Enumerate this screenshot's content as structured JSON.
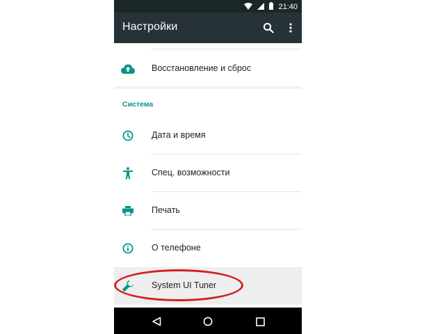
{
  "statusbar": {
    "time": "21:40",
    "icons": [
      "wifi-icon",
      "signal-icon",
      "battery-icon"
    ]
  },
  "appbar": {
    "title": "Настройки",
    "actions": [
      "search-icon",
      "more-vert-icon"
    ]
  },
  "top_item": {
    "label": "Восстановление и сброс",
    "icon": "cloud-upload-icon"
  },
  "section": {
    "header": "Система",
    "items": [
      {
        "label": "Дата и время",
        "icon": "clock-icon"
      },
      {
        "label": "Спец. возможности",
        "icon": "accessibility-icon"
      },
      {
        "label": "Печать",
        "icon": "printer-icon"
      },
      {
        "label": "О телефоне",
        "icon": "info-icon"
      },
      {
        "label": "System UI Tuner",
        "icon": "wrench-icon",
        "highlighted": true
      }
    ]
  },
  "navbar": {
    "buttons": [
      "back-icon",
      "home-icon",
      "recents-icon"
    ]
  },
  "colors": {
    "appbar": "#263238",
    "statusbar": "#1b2629",
    "accent": "#009688",
    "icon": "#009688",
    "highlight_ring": "#d21f1f",
    "background": "#f2f2f2"
  }
}
